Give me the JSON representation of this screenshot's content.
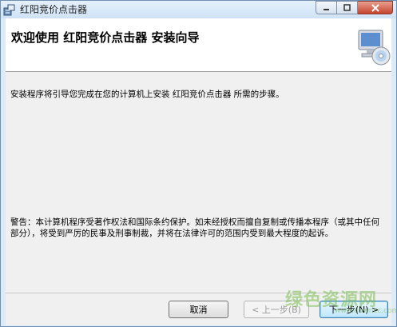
{
  "window": {
    "title": "红阳竞价点击器",
    "icon": "installer-icon"
  },
  "header": {
    "heading": "欢迎使用  红阳竞价点击器  安装向导",
    "icon": "computer-cd-icon"
  },
  "body": {
    "intro": "安装程序将引导您完成在您的计算机上安装 红阳竞价点击器 所需的步骤。",
    "warning": "警告：本计算机程序受著作权法和国际条约保护。如未经授权而擅自复制或传播本程序（或其中任何部分），将受到严厉的民事及刑事制裁，并将在法律许可的范围内受到最大程度的起诉。"
  },
  "buttons": {
    "cancel": "取消",
    "back": "< 上一步(B)",
    "next": "下一步(N) >"
  },
  "watermark": {
    "text": "绿色资源网",
    "url": "www.downcc.com"
  },
  "colors": {
    "titlebar": "#cfe2f5",
    "close_button": "#c5432d",
    "watermark": "#78be50"
  }
}
